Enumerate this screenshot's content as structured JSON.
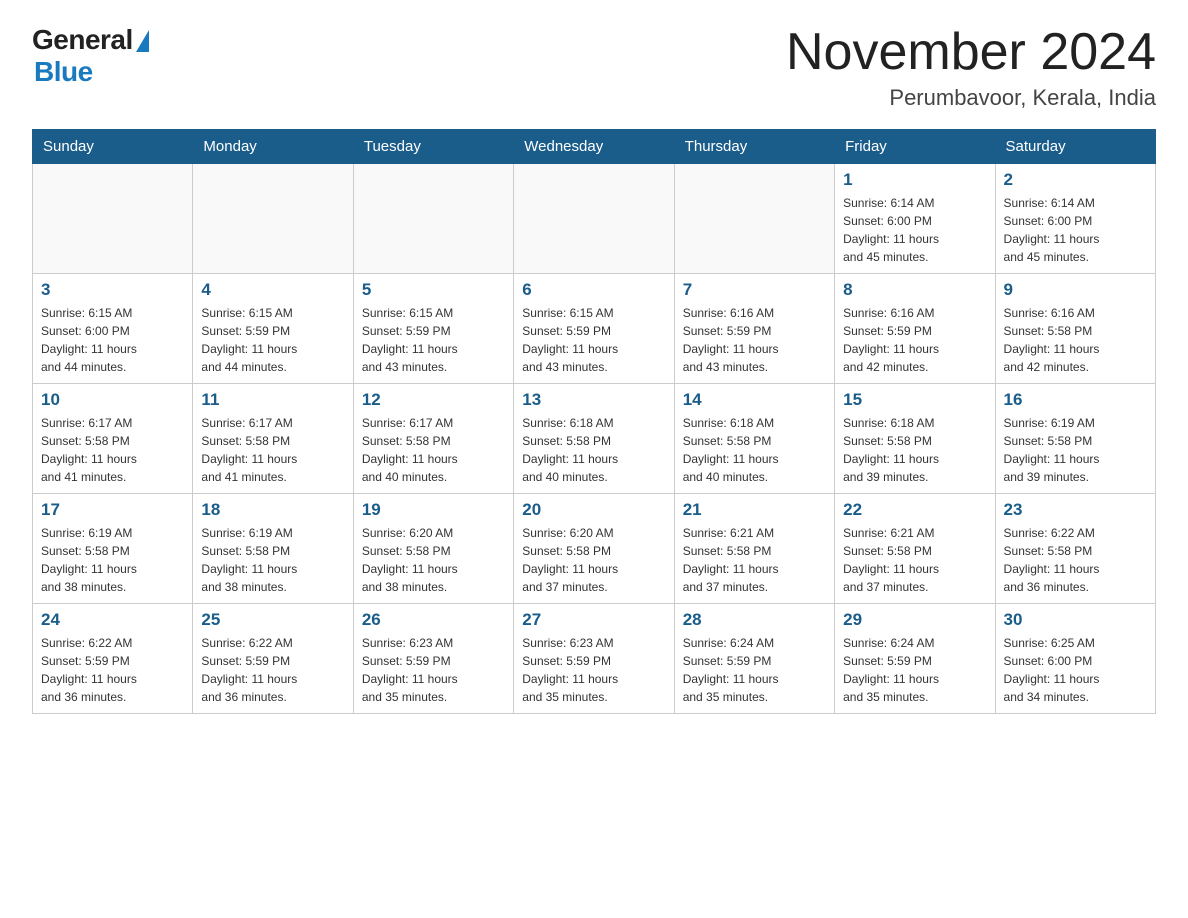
{
  "logo": {
    "general": "General",
    "triangle": "▶",
    "blue": "Blue"
  },
  "title": {
    "month_year": "November 2024",
    "location": "Perumbavoor, Kerala, India"
  },
  "header_days": [
    "Sunday",
    "Monday",
    "Tuesday",
    "Wednesday",
    "Thursday",
    "Friday",
    "Saturday"
  ],
  "weeks": [
    [
      {
        "day": "",
        "info": ""
      },
      {
        "day": "",
        "info": ""
      },
      {
        "day": "",
        "info": ""
      },
      {
        "day": "",
        "info": ""
      },
      {
        "day": "",
        "info": ""
      },
      {
        "day": "1",
        "info": "Sunrise: 6:14 AM\nSunset: 6:00 PM\nDaylight: 11 hours\nand 45 minutes."
      },
      {
        "day": "2",
        "info": "Sunrise: 6:14 AM\nSunset: 6:00 PM\nDaylight: 11 hours\nand 45 minutes."
      }
    ],
    [
      {
        "day": "3",
        "info": "Sunrise: 6:15 AM\nSunset: 6:00 PM\nDaylight: 11 hours\nand 44 minutes."
      },
      {
        "day": "4",
        "info": "Sunrise: 6:15 AM\nSunset: 5:59 PM\nDaylight: 11 hours\nand 44 minutes."
      },
      {
        "day": "5",
        "info": "Sunrise: 6:15 AM\nSunset: 5:59 PM\nDaylight: 11 hours\nand 43 minutes."
      },
      {
        "day": "6",
        "info": "Sunrise: 6:15 AM\nSunset: 5:59 PM\nDaylight: 11 hours\nand 43 minutes."
      },
      {
        "day": "7",
        "info": "Sunrise: 6:16 AM\nSunset: 5:59 PM\nDaylight: 11 hours\nand 43 minutes."
      },
      {
        "day": "8",
        "info": "Sunrise: 6:16 AM\nSunset: 5:59 PM\nDaylight: 11 hours\nand 42 minutes."
      },
      {
        "day": "9",
        "info": "Sunrise: 6:16 AM\nSunset: 5:58 PM\nDaylight: 11 hours\nand 42 minutes."
      }
    ],
    [
      {
        "day": "10",
        "info": "Sunrise: 6:17 AM\nSunset: 5:58 PM\nDaylight: 11 hours\nand 41 minutes."
      },
      {
        "day": "11",
        "info": "Sunrise: 6:17 AM\nSunset: 5:58 PM\nDaylight: 11 hours\nand 41 minutes."
      },
      {
        "day": "12",
        "info": "Sunrise: 6:17 AM\nSunset: 5:58 PM\nDaylight: 11 hours\nand 40 minutes."
      },
      {
        "day": "13",
        "info": "Sunrise: 6:18 AM\nSunset: 5:58 PM\nDaylight: 11 hours\nand 40 minutes."
      },
      {
        "day": "14",
        "info": "Sunrise: 6:18 AM\nSunset: 5:58 PM\nDaylight: 11 hours\nand 40 minutes."
      },
      {
        "day": "15",
        "info": "Sunrise: 6:18 AM\nSunset: 5:58 PM\nDaylight: 11 hours\nand 39 minutes."
      },
      {
        "day": "16",
        "info": "Sunrise: 6:19 AM\nSunset: 5:58 PM\nDaylight: 11 hours\nand 39 minutes."
      }
    ],
    [
      {
        "day": "17",
        "info": "Sunrise: 6:19 AM\nSunset: 5:58 PM\nDaylight: 11 hours\nand 38 minutes."
      },
      {
        "day": "18",
        "info": "Sunrise: 6:19 AM\nSunset: 5:58 PM\nDaylight: 11 hours\nand 38 minutes."
      },
      {
        "day": "19",
        "info": "Sunrise: 6:20 AM\nSunset: 5:58 PM\nDaylight: 11 hours\nand 38 minutes."
      },
      {
        "day": "20",
        "info": "Sunrise: 6:20 AM\nSunset: 5:58 PM\nDaylight: 11 hours\nand 37 minutes."
      },
      {
        "day": "21",
        "info": "Sunrise: 6:21 AM\nSunset: 5:58 PM\nDaylight: 11 hours\nand 37 minutes."
      },
      {
        "day": "22",
        "info": "Sunrise: 6:21 AM\nSunset: 5:58 PM\nDaylight: 11 hours\nand 37 minutes."
      },
      {
        "day": "23",
        "info": "Sunrise: 6:22 AM\nSunset: 5:58 PM\nDaylight: 11 hours\nand 36 minutes."
      }
    ],
    [
      {
        "day": "24",
        "info": "Sunrise: 6:22 AM\nSunset: 5:59 PM\nDaylight: 11 hours\nand 36 minutes."
      },
      {
        "day": "25",
        "info": "Sunrise: 6:22 AM\nSunset: 5:59 PM\nDaylight: 11 hours\nand 36 minutes."
      },
      {
        "day": "26",
        "info": "Sunrise: 6:23 AM\nSunset: 5:59 PM\nDaylight: 11 hours\nand 35 minutes."
      },
      {
        "day": "27",
        "info": "Sunrise: 6:23 AM\nSunset: 5:59 PM\nDaylight: 11 hours\nand 35 minutes."
      },
      {
        "day": "28",
        "info": "Sunrise: 6:24 AM\nSunset: 5:59 PM\nDaylight: 11 hours\nand 35 minutes."
      },
      {
        "day": "29",
        "info": "Sunrise: 6:24 AM\nSunset: 5:59 PM\nDaylight: 11 hours\nand 35 minutes."
      },
      {
        "day": "30",
        "info": "Sunrise: 6:25 AM\nSunset: 6:00 PM\nDaylight: 11 hours\nand 34 minutes."
      }
    ]
  ]
}
